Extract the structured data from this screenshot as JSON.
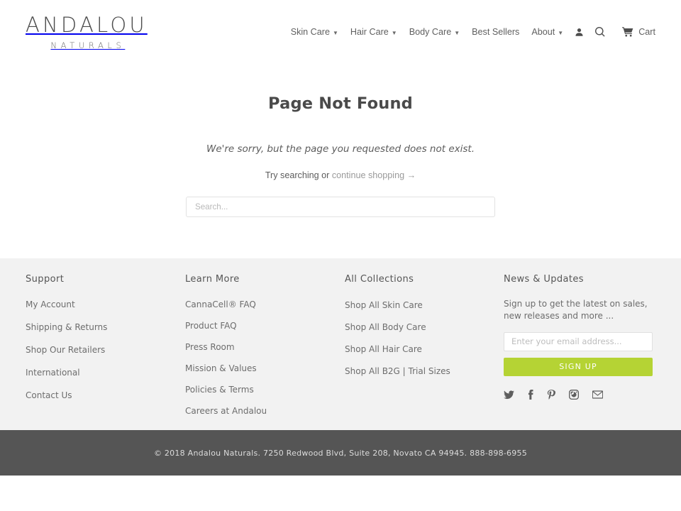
{
  "header": {
    "logo": {
      "main": "ANDALOU",
      "sub": "NATURALS"
    },
    "nav": [
      {
        "label": "Skin Care",
        "caret": "▼"
      },
      {
        "label": "Hair Care",
        "caret": "▼"
      },
      {
        "label": "Body Care",
        "caret": "▼"
      },
      {
        "label": "Best Sellers",
        "caret": ""
      },
      {
        "label": "About",
        "caret": "▼"
      }
    ],
    "icons": [
      {
        "name": "account-icon"
      },
      {
        "name": "search-icon"
      }
    ],
    "cart": {
      "label": "Cart",
      "icon": "cart-icon"
    }
  },
  "main": {
    "title": "Page Not Found",
    "message": "We're sorry, but the page you requested does not exist.",
    "try_prefix": "Try searching or ",
    "continue_link": "continue shopping →",
    "search_placeholder": "Search..."
  },
  "footer": {
    "columns": [
      {
        "title": "Support",
        "links": [
          "My Account",
          "Shipping & Returns",
          "Shop Our Retailers",
          "International",
          "Contact Us"
        ]
      },
      {
        "title": "Learn More",
        "links": [
          "CannaCell® FAQ",
          "Product FAQ",
          "Press Room",
          "Mission & Values",
          "Policies & Terms",
          "Careers at Andalou"
        ]
      },
      {
        "title": "All Collections",
        "links": [
          "Shop All Skin Care",
          "Shop All Body Care",
          "Shop All Hair Care",
          "Shop All B2G | Trial Sizes"
        ]
      }
    ],
    "newsletter": {
      "title": "News & Updates",
      "text": "Sign up to get the latest on sales, new releases and more ...",
      "email_placeholder": "Enter your email address...",
      "button_label": "SIGN UP",
      "button_color": "#b5d334",
      "social": [
        "twitter-icon",
        "facebook-icon",
        "pinterest-icon",
        "instagram-icon",
        "email-icon"
      ]
    },
    "copyright": "© 2018 Andalou Naturals. 7250 Redwood Blvd, Suite 208, Novato CA 94945. 888-898-6955"
  },
  "colors": {
    "footer_bg": "#f2f2f2",
    "copyright_bg": "#555555",
    "accent": "#b5d334"
  }
}
